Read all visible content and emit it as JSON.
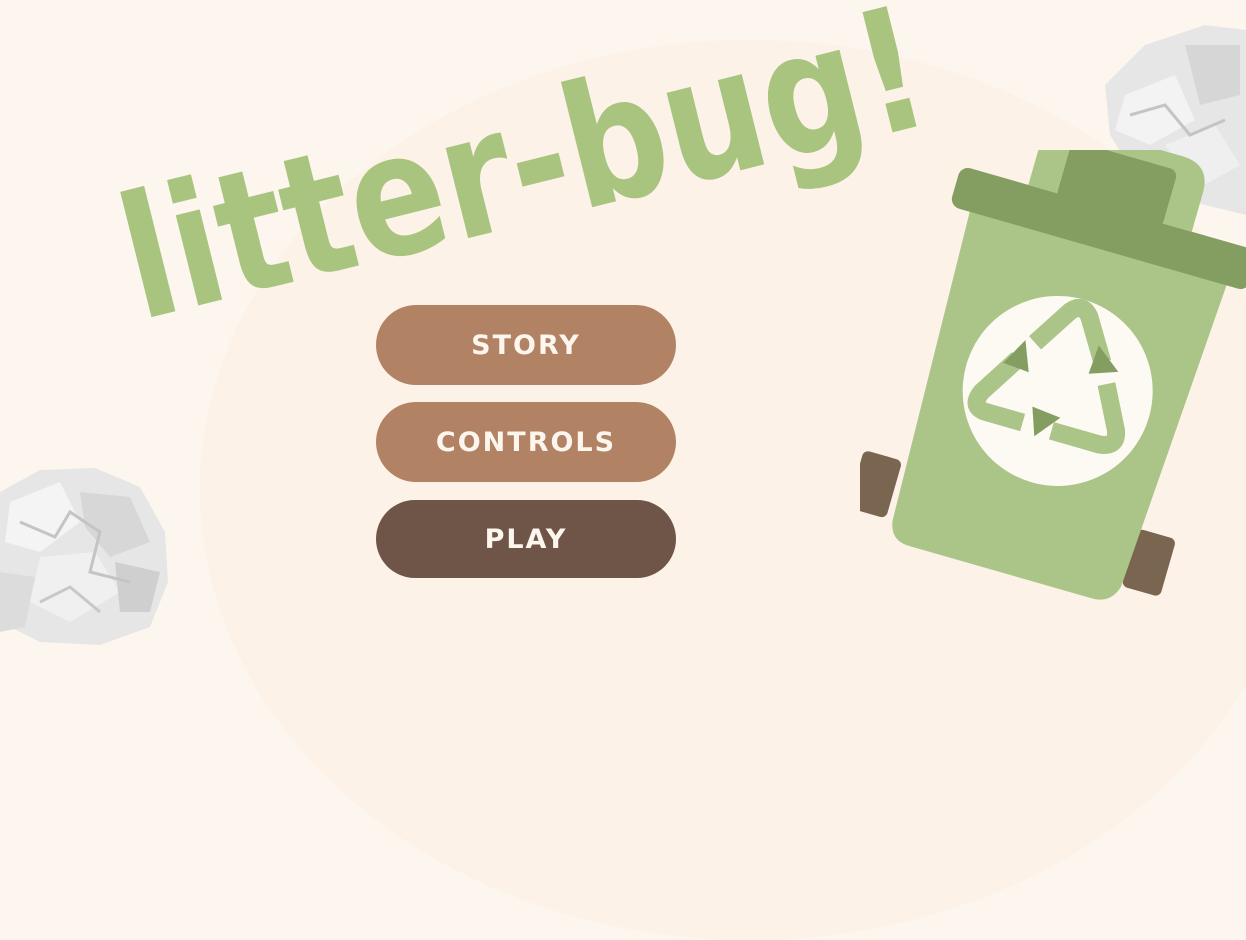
{
  "game": {
    "title": "litter-bug!"
  },
  "menu": {
    "story_label": "STORY",
    "controls_label": "CONTROLS",
    "play_label": "PLAY"
  },
  "colors": {
    "background": "#fdf6ee",
    "title_green": "#a9c47f",
    "bin_green": "#abc588",
    "bin_dark_green": "#849e62",
    "button_brown": "#b28264",
    "button_dark_brown": "#6e5547",
    "wheel_brown": "#7a6650"
  },
  "icons": {
    "trash_bin": "recycling-bin-icon",
    "paper_ball": "crumpled-paper-icon",
    "recycle": "recycle-icon"
  }
}
